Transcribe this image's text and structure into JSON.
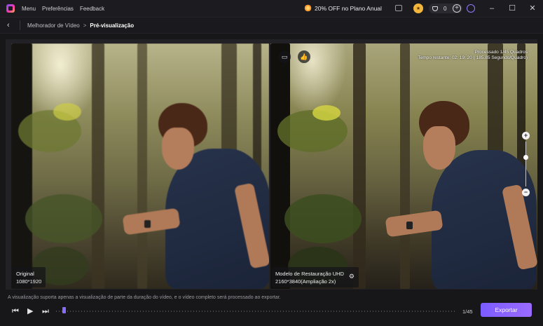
{
  "titlebar": {
    "menu": [
      "Menu",
      "Preferências",
      "Feedback"
    ],
    "promo": "20% OFF no Plano Anual",
    "credits": "0"
  },
  "breadcrumb": {
    "parent": "Melhorador de Vídeo",
    "separator": ">",
    "current": "Pré-visualização"
  },
  "preview": {
    "original": {
      "title": "Original",
      "resolution": "1080*1920"
    },
    "enhanced": {
      "title": "Modelo de Restauração UHD",
      "resolution": "2160*3840(Ampliação 2x)"
    },
    "processing": {
      "frames": "Processado 1/45 Quadros",
      "time": "Tempo restante: 02: 19: 20 ( 185.85 Segundo/Quadro)"
    }
  },
  "footer": {
    "notice": "A visualização suporta apenas a visualização de parte da duração do vídeo, e o vídeo completo será processado ao exportar.",
    "frame_count": "1/45",
    "export_label": "Exportar",
    "progress": 0.02
  },
  "icons": {
    "accent": "#8b6bff"
  }
}
